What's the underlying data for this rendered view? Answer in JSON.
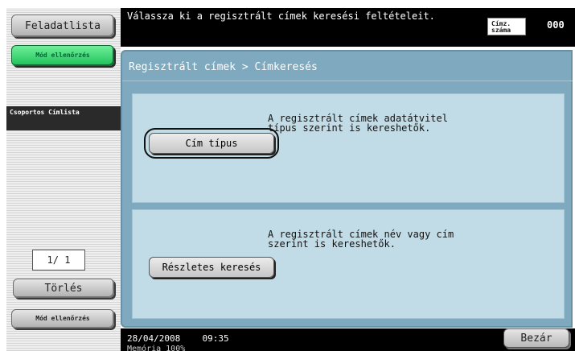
{
  "sidebar": {
    "job_list_label": "Feladatlista",
    "mode_check_top_label": "Mód ellenőrzés",
    "group_list_label": "Csoportos Címlista",
    "page_count": "1/ 1",
    "delete_label": "Törlés",
    "mode_check_bottom_label": "Mód ellenőrzés"
  },
  "header": {
    "message": "Válassza ki a regisztrált címek keresési feltételeit.",
    "address_count_label": "Címz. száma",
    "address_count_value": "000"
  },
  "main": {
    "breadcrumb": "Regisztrált címek > Címkeresés",
    "options": [
      {
        "button_label": "Cím típus",
        "description": "A regisztrált címek adatátvitel típus szerint is kereshetők."
      },
      {
        "button_label": "Részletes keresés",
        "description": "A regisztrált címek név vagy cím szerint is kereshetők."
      }
    ]
  },
  "status": {
    "date": "28/04/2008",
    "time": "09:35",
    "memory": "Memória      100%",
    "close_label": "Bezár"
  },
  "colors": {
    "panel_bg": "#7fa9be",
    "option_bg": "#c2dce7",
    "mode_check_green": "#1fc25a",
    "bar_black": "#000000"
  }
}
